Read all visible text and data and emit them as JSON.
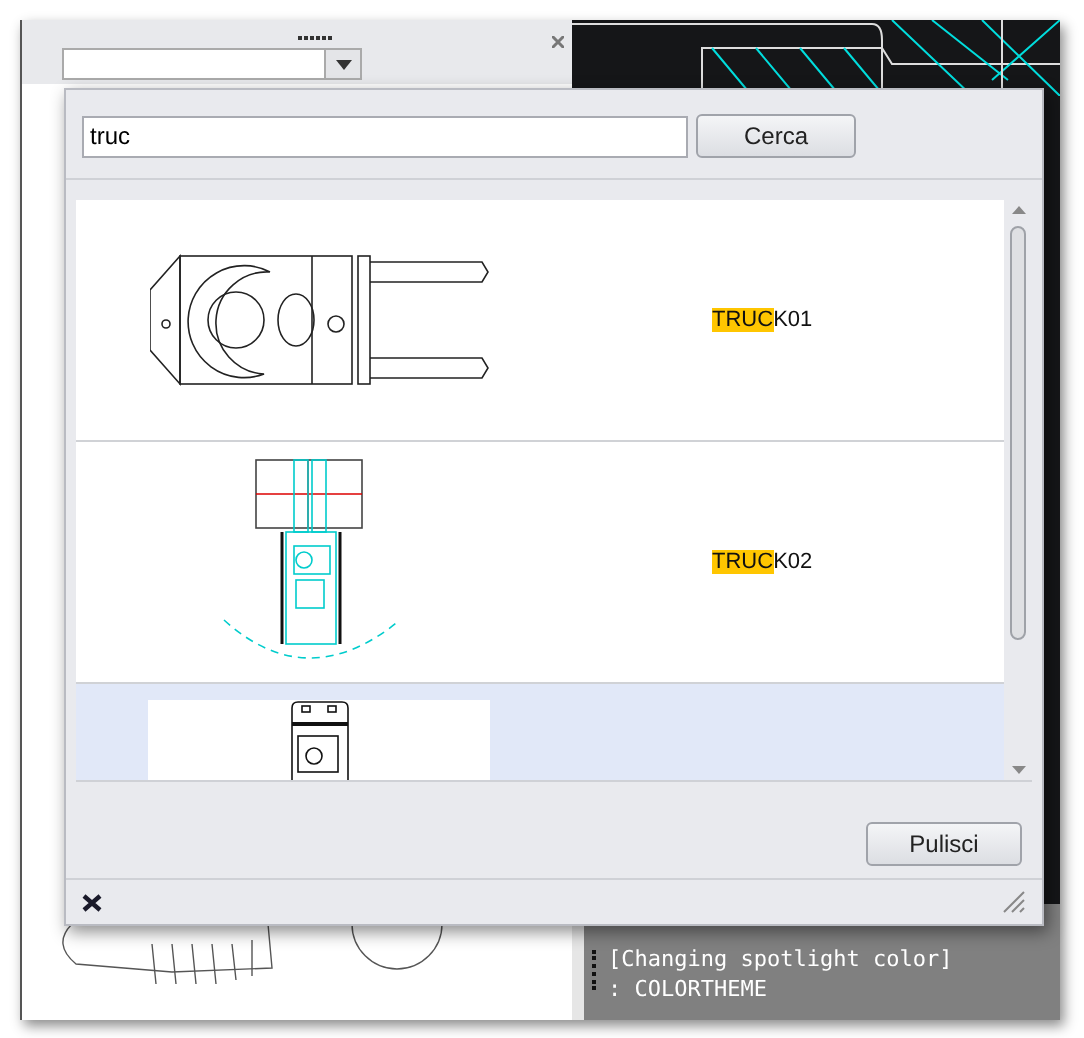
{
  "search": {
    "value": "truc",
    "button": "Cerca"
  },
  "results": [
    {
      "kind": "side-view",
      "match": "TRUC",
      "rest": "K01",
      "selected": false
    },
    {
      "kind": "top-view",
      "match": "TRUC",
      "rest": "K02",
      "selected": false
    },
    {
      "kind": "front-view",
      "selected": true
    }
  ],
  "clear_button": "Pulisci",
  "command_line": [
    "[Changing spotlight color]",
    ": COLORTHEME"
  ]
}
